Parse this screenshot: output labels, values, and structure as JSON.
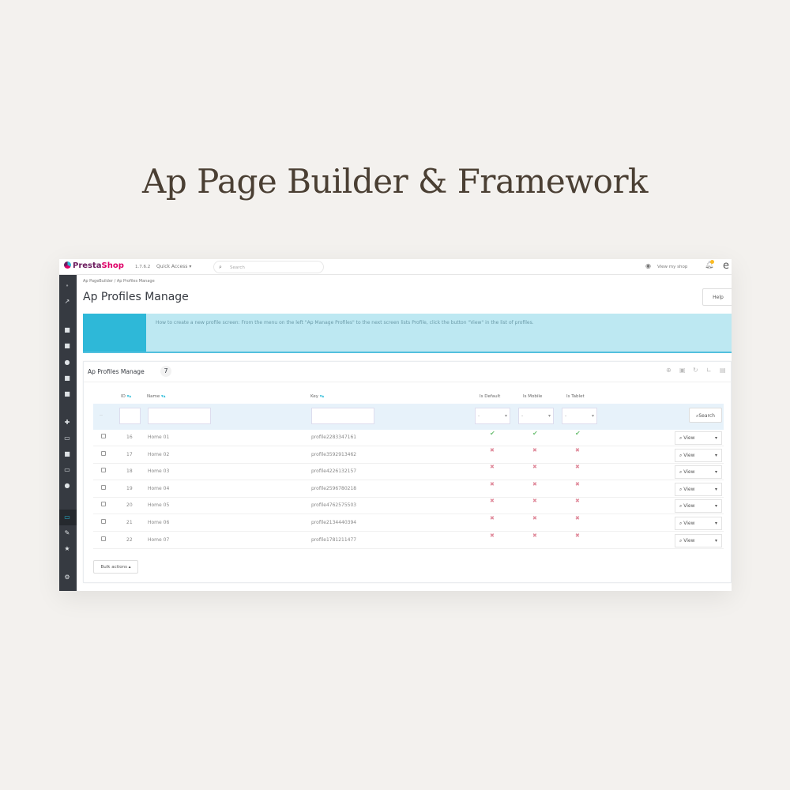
{
  "hero_title": "Ap Page Builder & Framework",
  "topbar": {
    "logo_a": "Presta",
    "logo_b": "Shop",
    "version": "1.7.6.2",
    "quick_access": "Quick Access ▾",
    "search_placeholder": "Search",
    "view_shop": "View my shop",
    "notifications": "1"
  },
  "breadcrumb": {
    "parent": "Ap PageBuilder",
    "sep": "/",
    "current": "Ap Profiles Manage"
  },
  "page_title": "Ap Profiles Manage",
  "help_label": "Help",
  "banner_text": "How to create a new profile screen: From the menu on the left \"Ap Manage Profiles\" to the next screen lists Profile, click the button \"View\" in the list of profiles.",
  "panel": {
    "title": "Ap Profiles Manage",
    "count": "7"
  },
  "columns": {
    "id": "ID",
    "name": "Name",
    "key": "Key",
    "default": "Is Default",
    "mobile": "Is Mobile",
    "tablet": "Is Tablet"
  },
  "filter": {
    "select_value": "-",
    "search_label": "Search",
    "dash": "--"
  },
  "rows": [
    {
      "id": "16",
      "name": "Home 01",
      "key": "profile2283347161",
      "default": true,
      "mobile": true,
      "tablet": true
    },
    {
      "id": "17",
      "name": "Home 02",
      "key": "profile3592913462",
      "default": false,
      "mobile": false,
      "tablet": false
    },
    {
      "id": "18",
      "name": "Home 03",
      "key": "profile4226132157",
      "default": false,
      "mobile": false,
      "tablet": false
    },
    {
      "id": "19",
      "name": "Home 04",
      "key": "profile2596780218",
      "default": false,
      "mobile": false,
      "tablet": false
    },
    {
      "id": "20",
      "name": "Home 05",
      "key": "profile4762575503",
      "default": false,
      "mobile": false,
      "tablet": false
    },
    {
      "id": "21",
      "name": "Home 06",
      "key": "profile2134440394",
      "default": false,
      "mobile": false,
      "tablet": false
    },
    {
      "id": "22",
      "name": "Home 07",
      "key": "profile1781211477",
      "default": false,
      "mobile": false,
      "tablet": false
    }
  ],
  "view_label": "View",
  "bulk_label": "Bulk actions ▴",
  "colors": {
    "accent": "#25b9d7",
    "sidebar": "#363a41",
    "ok": "#72c279",
    "no": "#e08a9b"
  }
}
